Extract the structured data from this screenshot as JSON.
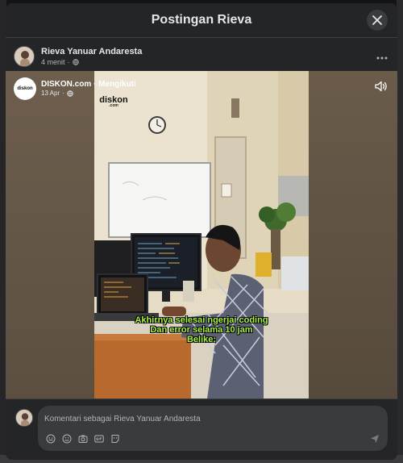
{
  "dialog": {
    "title": "Postingan Rieva"
  },
  "post": {
    "author": "Rieva Yanuar Andaresta",
    "time": "4 menit",
    "more_icon": "more-horizontal-icon"
  },
  "shared": {
    "page_name": "DISKON.com",
    "follow_label": "Mengikuti",
    "date": "13 Apr",
    "logo_text": "diskon"
  },
  "video": {
    "watermark": "diskon",
    "watermark_sub": ".com",
    "subtitles": [
      "Akhirnya selesai ngerjai coding",
      "Dan error selama 10 jam",
      "Belike:"
    ],
    "subtitle_color": "#a8f04a"
  },
  "comment": {
    "placeholder": "Komentari sebagai Rieva Yanuar Andaresta",
    "tools": [
      "sticker-icon",
      "emoji-icon",
      "camera-icon",
      "gif-icon",
      "avatar-sticker-icon"
    ]
  },
  "colors": {
    "dialog_bg": "#242526",
    "input_bg": "#3a3b3c",
    "text_primary": "#e4e6eb",
    "text_secondary": "#b0b3b8"
  }
}
